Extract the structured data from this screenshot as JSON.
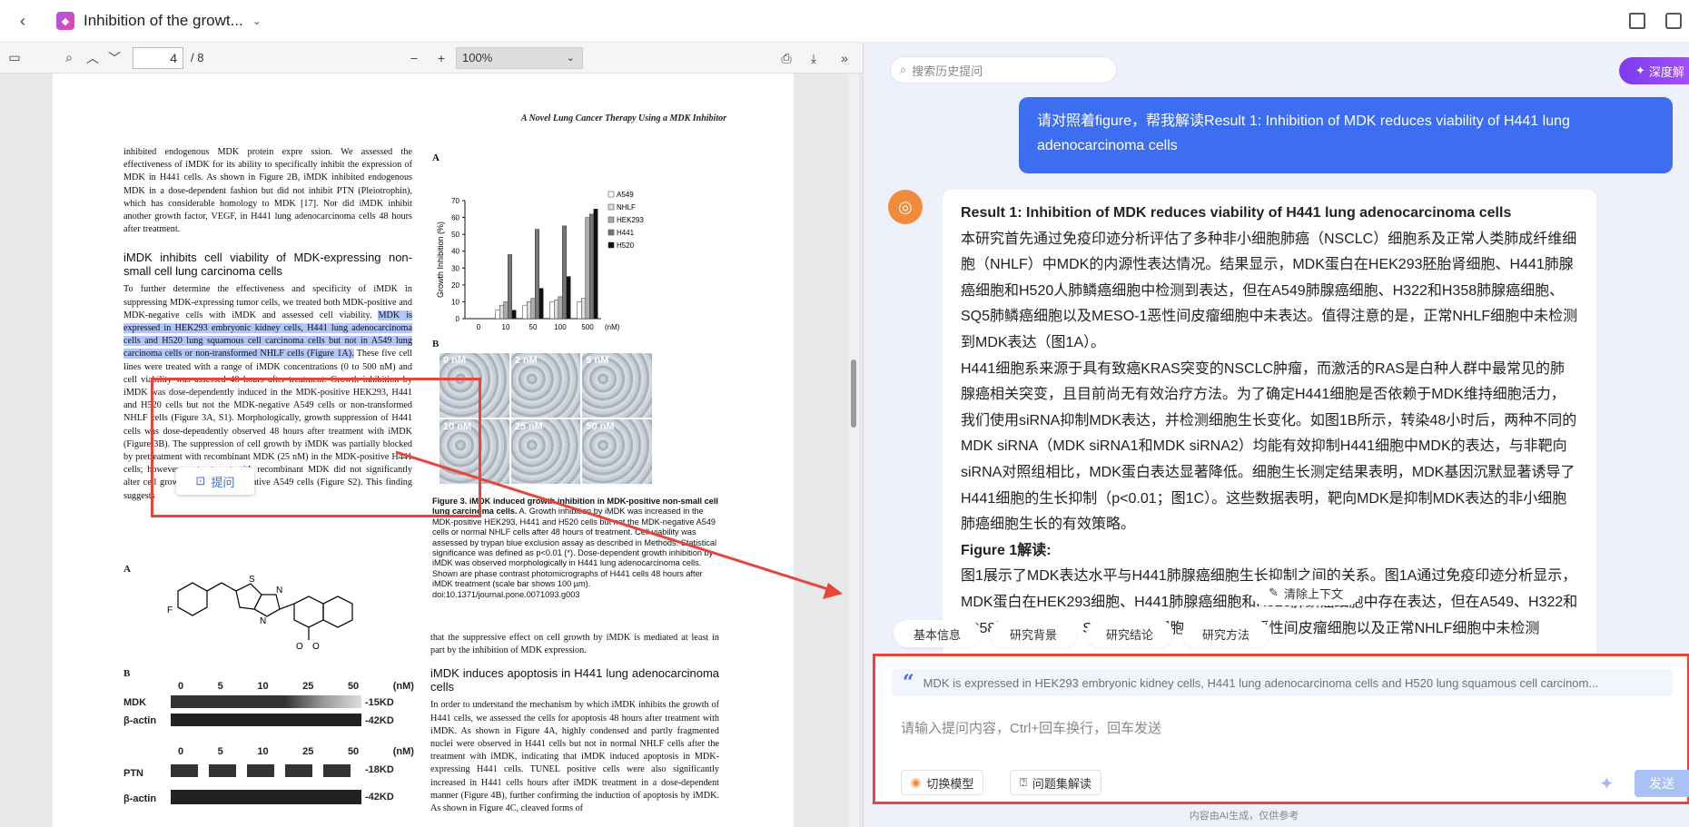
{
  "topbar": {
    "title": "Inhibition of the growt...",
    "chevron": "⌄"
  },
  "pdf_toolbar": {
    "page_current": "4",
    "page_total": "/ 8",
    "zoom": "100%"
  },
  "pdf": {
    "running_head": "A Novel Lung Cancer Therapy Using a MDK Inhibitor",
    "left_para1": "inhibited endogenous MDK protein expre ssion. We assessed the effectiveness of iMDK for its ability to specifically inhibit the expression of MDK in H441 cells. As shown in Figure 2B, iMDK inhibited endogenous MDK in a dose-dependent fashion but did not inhibit PTN (Pleiotrophin), which has considerable homology to MDK [17]. Nor did iMDK inhibit another growth factor, VEGF, in H441 lung adenocarcinoma cells 48 hours after treatment.",
    "left_heading": "iMDK inhibits cell viability of MDK-expressing non-small cell lung carcinoma cells",
    "left_para2_pre": "To further determine the effectiveness and specificity of iMDK in suppressing MDK-expressing tumor cells, we treated both MDK-positive and MDK-negative cells with iMDK and assessed cell viability.",
    "left_para2_hl": "MDK is expressed in HEK293 embryonic kidney cells, H441 lung adenocarcinoma cells and H520 lung squamous cell carcinoma cells but not in A549 lung carcinoma cells or non-transformed NHLF cells (Figure 1A).",
    "left_para2_post": "These five cell lines were treated with a range of iMDK concentrations (0 to 500 nM) and cell viability was assessed 48 hours after treatment. Growth inhibition by iMDK was dose-dependently induced in the MDK-positive HEK293, H441 and H520 cells but not the MDK-negative A549 cells or non-transformed NHLF cells (Figure 3A, S1). Morphologically, growth suppression of H441 cells was dose-dependently observed 48 hours after treatment with iMDK (Figure 3B). The suppression of cell growth by iMDK was partially blocked by pretreatment with recombinant MDK (25 nM) in the MDK-positive H441 cells; however, pretreatment with recombinant MDK did not significantly alter cell growth in the MDK-negative A549 cells (Figure S2). This finding suggests",
    "right_para1": "that the suppressive effect on cell growth by iMDK is mediated at least in part by the inhibition of MDK expression.",
    "right_heading": "iMDK induces apoptosis in H441 lung adenocarcinoma cells",
    "right_para2": "In order to understand the mechanism by which iMDK inhibits the growth of H441 cells, we assessed the cells for apoptosis 48 hours after treatment with iMDK. As shown in Figure 4A, highly condensed and partly fragmented nuclei were observed in H441 cells but not in normal NHLF cells after the treatment with iMDK, indicating that iMDK induced apoptosis in MDK-expressing H441 cells. TUNEL positive cells were also significantly increased in H441 cells hours after iMDK treatment in a dose-dependent manner (Figure 4B), further confirming the induction of apoptosis by iMDK. As shown in Figure 4C, cleaved forms of",
    "fig_caption_bold": "Figure 3. iMDK induced growth inhibition in MDK-positive non-small cell lung carcinoma cells.",
    "fig_caption_text": "A. Growth inhibition by iMDK was increased in the MDK-positive HEK293, H441 and H520 cells but not the MDK-negative A549 cells or normal NHLF cells after 48 hours of treatment. Cell viability was assessed by trypan blue exclusion assay as described in Methods. Statistical significance was defined as p<0.01 (*). Dose-dependent growth inhibition by iMDK was observed morphologically in H441 lung adenocarcinoma cells. Shown are phase contrast photomicrographs of H441 cells 48 hours after iMDK treatment (scale bar shows 100 µm).",
    "fig_doi": "doi:10.1371/journal.pone.0071093.g003",
    "fig_a_label": "A",
    "fig_b_label": "B",
    "chem_a_label": "A",
    "blot_b_label": "B",
    "ask_button": "提问",
    "micrographs": [
      "0 nM",
      "2 nM",
      "5 nM",
      "10 nM",
      "25 nM",
      "50 nM"
    ],
    "blot": {
      "doses": [
        "0",
        "5",
        "10",
        "25",
        "50",
        "(nM)"
      ],
      "rows": [
        {
          "name": "MDK",
          "kd": "-15KD"
        },
        {
          "name": "β-actin",
          "kd": "-42KD"
        },
        {
          "name": "PTN",
          "kd": "-18KD"
        },
        {
          "name": "β-actin",
          "kd": "-42KD"
        }
      ]
    }
  },
  "chart_data": {
    "type": "bar",
    "ylabel": "Growth Inhibition (%)",
    "ylim": [
      0,
      70
    ],
    "yticks": [
      0,
      10,
      20,
      30,
      40,
      50,
      60,
      70
    ],
    "categories": [
      "0",
      "10",
      "50",
      "100",
      "500"
    ],
    "xunit": "(nM)",
    "series": [
      {
        "name": "A549",
        "values": [
          0,
          5,
          8,
          10,
          10
        ],
        "color": "#ffffff"
      },
      {
        "name": "NHLF",
        "values": [
          0,
          8,
          10,
          11,
          12
        ],
        "color": "#dddddd"
      },
      {
        "name": "HEK293",
        "values": [
          0,
          10,
          12,
          13,
          60
        ],
        "color": "#aaaaaa"
      },
      {
        "name": "H441",
        "values": [
          0,
          38,
          53,
          55,
          62
        ],
        "color": "#777777"
      },
      {
        "name": "H520",
        "values": [
          0,
          5,
          18,
          25,
          65
        ],
        "color": "#111111"
      }
    ]
  },
  "chat": {
    "search_placeholder": "搜索历史提问",
    "deep_button": "深度解",
    "user_message": "请对照着figure，帮我解读Result 1: Inhibition of MDK reduces viability of H441 lung adenocarcinoma cells",
    "answer_title": "Result 1: Inhibition of MDK reduces viability of H441 lung adenocarcinoma cells",
    "answer_p1": "本研究首先通过免疫印迹分析评估了多种非小细胞肺癌（NSCLC）细胞系及正常人类肺成纤维细胞（NHLF）中MDK的内源性表达情况。结果显示，MDK蛋白在HEK293胚胎肾细胞、H441肺腺癌细胞和H520人肺鳞癌细胞中检测到表达，但在A549肺腺癌细胞、H322和H358肺腺癌细胞、SQ5肺鳞癌细胞以及MESO-1恶性间皮瘤细胞中未表达。值得注意的是，正常NHLF细胞中未检测到MDK表达（图1A）。",
    "answer_p2": "H441细胞系来源于具有致癌KRAS突变的NSCLC肿瘤，而激活的RAS是白种人群中最常见的肺腺癌相关突变，且目前尚无有效治疗方法。为了确定H441细胞是否依赖于MDK维持细胞活力，我们使用siRNA抑制MDK表达，并检测细胞生长变化。如图1B所示，转染48小时后，两种不同的MDK siRNA（MDK siRNA1和MDK siRNA2）均能有效抑制H441细胞中MDK的表达，与非靶向siRNA对照组相比，MDK蛋白表达显著降低。细胞生长测定结果表明，MDK基因沉默显著诱导了H441细胞的生长抑制（p<0.01；图1C）。这些数据表明，靶向MDK是抑制MDK表达的非小细胞肺癌细胞生长的有效策略。",
    "answer_fig_heading": "Figure 1解读:",
    "answer_p3": "图1展示了MDK表达水平与H441肺腺癌细胞生长抑制之间的关系。图1A通过免疫印迹分析显示，MDK蛋白在HEK293细胞、H441肺腺癌细胞和H520肺鳞癌细胞中存在表达，但在A549、H322和H358肺腺癌细胞、SQ5肺鳞癌细胞、MESO-1恶性间皮瘤细胞以及正常NHLF细胞中未检测",
    "clear_context": "清除上下文",
    "chips": [
      "基本信息",
      "研究背景",
      "研究结论",
      "研究方法"
    ],
    "quote_text": "MDK is expressed in HEK293 embryonic kidney cells, H441 lung adenocarcinoma cells and H520 lung squamous cell carcinom...",
    "input_placeholder": "请输入提问内容，Ctrl+回车换行，回车发送",
    "switch_model": "切换模型",
    "question_set": "问题集解读",
    "send": "发送",
    "footer": "内容由AI生成，仅供参考"
  }
}
